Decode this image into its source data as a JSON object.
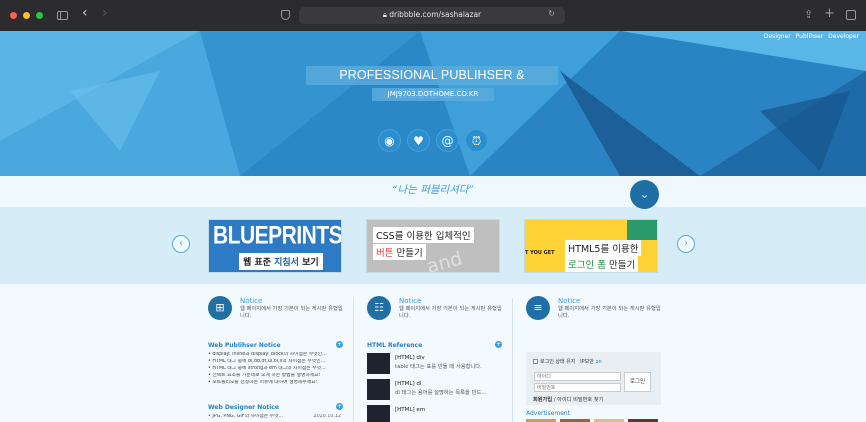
{
  "browser": {
    "url": "dribbble.com/sashalazar"
  },
  "hero": {
    "nav": [
      "Designer",
      "Publihser",
      "Developer"
    ],
    "title": "PROFESSIONAL PUBLIHSER & DESIGNER",
    "subtitle": "JMJ9703.DOTHOME.CO.KR",
    "social_icons": [
      "target-icon",
      "heart-icon",
      "at-icon",
      "alarm-icon"
    ]
  },
  "slogan": "“나는 퍼블리셔다”",
  "carousel": {
    "card1": {
      "big": "BLUEPRINTS",
      "label_a": "웹 표준 ",
      "label_b": "지침서",
      "label_c": " 보기"
    },
    "card2": {
      "line1": "CSS를 이용한 입체적인",
      "line2a": "버튼",
      "line2b": " 만들기",
      "ghost": "and inte"
    },
    "card3": {
      "line1": "HTML5를 이용한",
      "line2a": "로그인 폼",
      "line2b": " 만들기",
      "side": "T YOU GET"
    }
  },
  "notice_title": "Notice",
  "notice_desc": "웹 페이지에서 가장 기본이 되는 게시판 유형입니다.",
  "col1": {
    "sec1_title": "Web Publihser Notice",
    "sec1_items": [
      "• display: inline과 display: block의 차이점은 무엇인...",
      "• HTML 태그 중에 dl,dd,dt,ul,ol,li의 차이점은 무엇인...",
      "• HTML 태그 중에 strong과 em 태그의 차이점은 무엇...",
      "• 전택트 요소를 가운데로 오게 하는 방법을 설명하세요!",
      "• 포트폴리오를 선정하는 이유에 대하여 설명해주세요!"
    ],
    "sec2_title": "Web Designer Notice",
    "sec2_item": "• JPG, PNG, GIF의 차이점은 무엇...",
    "sec2_date": "2020.10.12"
  },
  "col2": {
    "sec_title": "HTML Reference",
    "items": [
      {
        "title": "[HTML] div",
        "desc": "table 태그는 표를 만들 때 사용합니다."
      },
      {
        "title": "[HTML] dl",
        "desc": "dl 태그는 용어를 설명하는 목록을 만드..."
      },
      {
        "title": "[HTML] em",
        "desc": ""
      }
    ]
  },
  "col3": {
    "keep_login": "로그인 상태 유지",
    "secure": "IP보안",
    "secure_state": "on",
    "id_placeholder": "아이디",
    "pw_placeholder": "비밀번호",
    "login_btn": "로그인",
    "join": "회원가입",
    "find": " / 아이디 비밀번호 찾기",
    "adv": "Advertisement"
  }
}
